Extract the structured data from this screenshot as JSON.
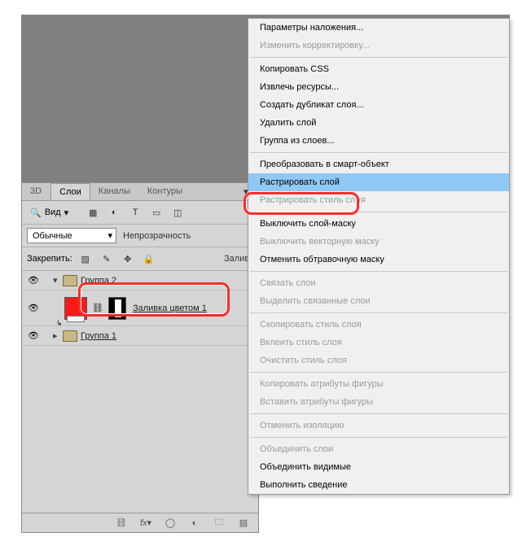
{
  "tabs": {
    "t3d": "3D",
    "layers": "Слои",
    "channels": "Каналы",
    "paths": "Контуры"
  },
  "filter": {
    "label": "Вид"
  },
  "blend": {
    "mode": "Обычные",
    "opacity_label": "Непрозрачность"
  },
  "lock": {
    "label": "Закрепить:",
    "fill_label": "Заливк"
  },
  "layers_list": {
    "group2": "Группа 2",
    "fill_layer": "Заливка цветом 1",
    "group1": "Группа 1"
  },
  "menu": {
    "blending_options": "Параметры наложения...",
    "edit_adjustment": "Изменить корректировку...",
    "copy_css": "Копировать CSS",
    "extract_assets": "Извлечь ресурсы...",
    "duplicate_layer": "Создать дубликат слоя...",
    "delete_layer": "Удалить слой",
    "group_from_layers": "Группа из слоев...",
    "convert_smart": "Преобразовать в смарт-объект",
    "rasterize_layer": "Растрировать слой",
    "rasterize_style": "Растрировать стиль слоя",
    "disable_mask": "Выключить слой-маску",
    "disable_vector_mask": "Выключить векторную маску",
    "release_clipping": "Отменить обтравочную маску",
    "link_layers": "Связать слои",
    "select_linked": "Выделить связанные слои",
    "copy_style": "Скопировать стиль слоя",
    "paste_style": "Вклеить стиль слоя",
    "clear_style": "Очистить стиль слоя",
    "copy_shape_attrs": "Копировать атрибуты фигуры",
    "paste_shape_attrs": "Вставить атрибуты фигуры",
    "release_isolation": "Отменить изоляцию",
    "merge_layers": "Объединить слои",
    "merge_visible": "Объединить видимые",
    "flatten": "Выполнить сведение"
  }
}
